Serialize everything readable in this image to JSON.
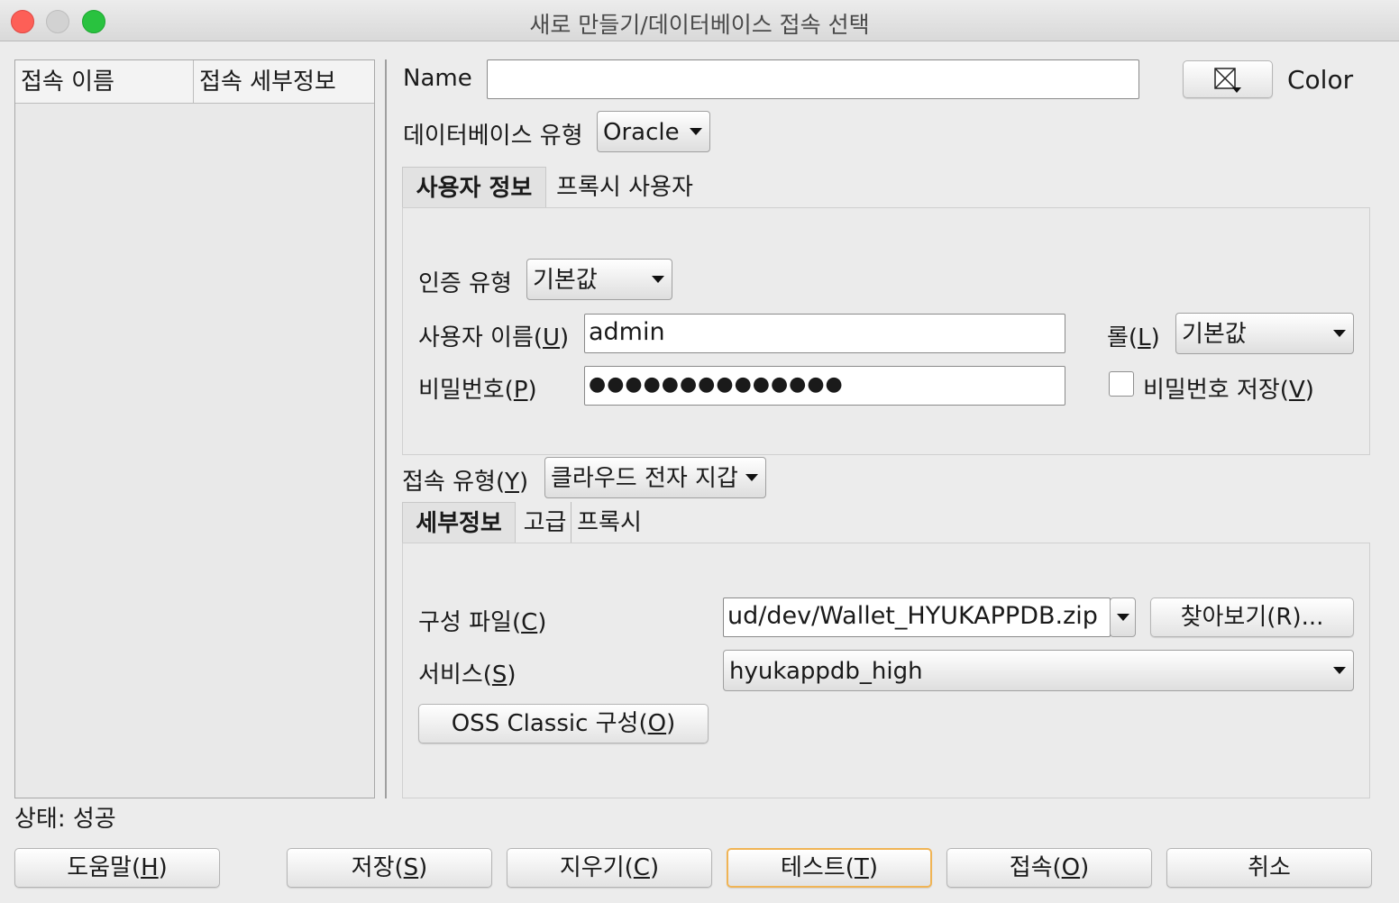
{
  "window": {
    "title": "새로 만들기/데이터베이스 접속 선택"
  },
  "connections": {
    "columns": [
      "접속 이름",
      "접속 세부정보"
    ],
    "rows": []
  },
  "name_label": "Name",
  "name_value": "",
  "color_label": "Color",
  "db_type": {
    "label": "데이터베이스 유형",
    "value": "Oracle"
  },
  "user_tabs": [
    "사용자 정보",
    "프록시 사용자"
  ],
  "auth": {
    "label": "인증 유형",
    "value": "기본값"
  },
  "username": {
    "label_main": "사용자 이름(",
    "mnemonic": "U",
    "label_end": ")",
    "value": "admin"
  },
  "password": {
    "label_main": "비밀번호(",
    "mnemonic": "P",
    "label_end": ")",
    "value": "●●●●●●●●●●●●●●"
  },
  "role": {
    "label_main": "롤(",
    "mnemonic": "L",
    "label_end": ")",
    "value": "기본값"
  },
  "save_password": {
    "label_main": "비밀번호 저장(",
    "mnemonic": "V",
    "label_end": ")",
    "checked": false
  },
  "conn_type": {
    "label_main": "접속 유형(",
    "mnemonic": "Y",
    "label_end": ")",
    "value": "클라우드 전자 지갑"
  },
  "detail_tabs": [
    "세부정보",
    "고급",
    "프록시"
  ],
  "config_file": {
    "label_main": "구성 파일(",
    "mnemonic": "C",
    "label_end": ")",
    "value": "ud/dev/Wallet_HYUKAPPDB.zip"
  },
  "browse_button": "찾아보기(R)...",
  "service": {
    "label_main": "서비스(",
    "mnemonic": "S",
    "label_end": ")",
    "value": "hyukappdb_high"
  },
  "oss_button": {
    "label_main": "OSS Classic 구성(",
    "mnemonic": "O",
    "label_end": ")"
  },
  "status": "상태: 성공",
  "buttons": {
    "help": {
      "main": "도움말(",
      "m": "H",
      "end": ")"
    },
    "save": {
      "main": "저장(",
      "m": "S",
      "end": ")"
    },
    "clear": {
      "main": "지우기(",
      "m": "C",
      "end": ")"
    },
    "test": {
      "main": "테스트(",
      "m": "T",
      "end": ")"
    },
    "connect": {
      "main": "접속(",
      "m": "O",
      "end": ")"
    },
    "cancel": "취소"
  }
}
